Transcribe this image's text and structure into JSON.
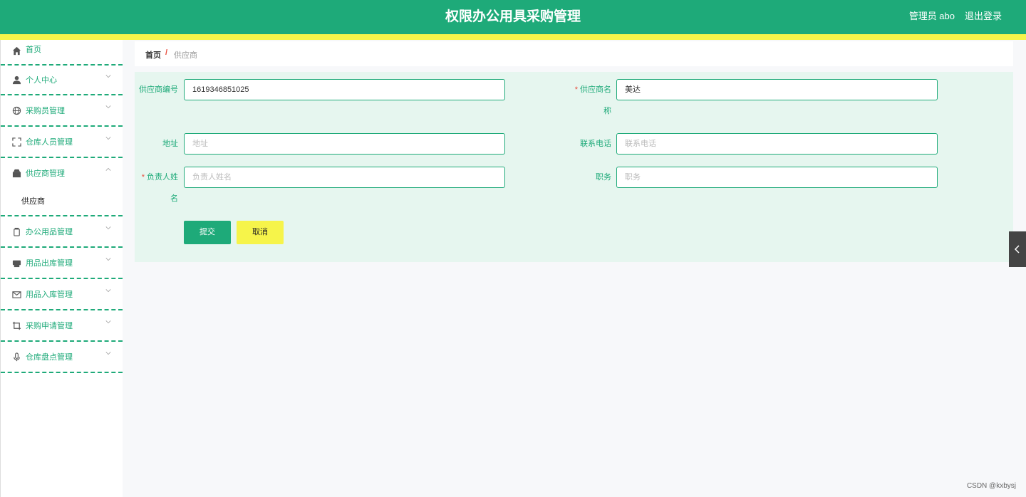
{
  "header": {
    "title": "权限办公用具采购管理",
    "user": "管理员 abo",
    "logout": "退出登录"
  },
  "sidebar": {
    "items": [
      {
        "label": "首页",
        "icon": "home-icon"
      },
      {
        "label": "个人中心",
        "icon": "user-icon"
      },
      {
        "label": "采购员管理",
        "icon": "globe-icon"
      },
      {
        "label": "仓库人员管理",
        "icon": "fullscreen-icon"
      },
      {
        "label": "供应商管理",
        "icon": "shop-icon",
        "submenu": [
          "供应商"
        ]
      },
      {
        "label": "办公用品管理",
        "icon": "bottle-icon"
      },
      {
        "label": "用品出库管理",
        "icon": "printer-icon"
      },
      {
        "label": "用品入库管理",
        "icon": "mail-icon"
      },
      {
        "label": "采购申请管理",
        "icon": "crop-icon"
      },
      {
        "label": "仓库盘点管理",
        "icon": "microphone-icon"
      }
    ]
  },
  "breadcrumb": {
    "home": "首页",
    "separator": "/",
    "current": "供应商"
  },
  "form": {
    "supplier_no": {
      "label": "供应商编号",
      "value": "1619346851025"
    },
    "supplier_name": {
      "label": "供应商名称",
      "value": "美达"
    },
    "address": {
      "label": "地址",
      "placeholder": "地址"
    },
    "phone": {
      "label": "联系电话",
      "placeholder": "联系电话"
    },
    "contact_name": {
      "label": "负责人姓名",
      "placeholder": "负责人姓名"
    },
    "position": {
      "label": "职务",
      "placeholder": "职务"
    },
    "required_mark": "*",
    "submit": "提交",
    "cancel": "取消"
  },
  "watermark": "CSDN @kxbysj",
  "colors": {
    "accent": "#1eaa79",
    "highlight": "#f6f44a",
    "required": "#e74c3c"
  }
}
